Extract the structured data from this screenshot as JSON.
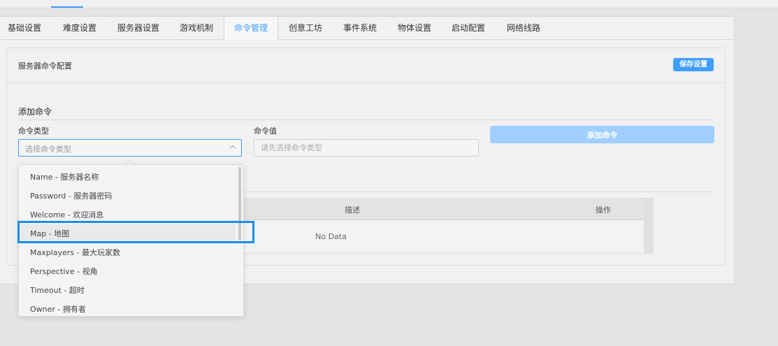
{
  "tabs": [
    {
      "label": "基础设置"
    },
    {
      "label": "难度设置"
    },
    {
      "label": "服务器设置"
    },
    {
      "label": "游戏机制"
    },
    {
      "label": "命令管理",
      "active": true
    },
    {
      "label": "创意工坊"
    },
    {
      "label": "事件系统"
    },
    {
      "label": "物体设置"
    },
    {
      "label": "启动配置"
    },
    {
      "label": "网络线路"
    }
  ],
  "card": {
    "title": "服务器命令配置",
    "save_label": "保存设置"
  },
  "add_section": {
    "title": "添加命令",
    "type_label": "命令类型",
    "type_placeholder": "选择命令类型",
    "value_label": "命令值",
    "value_placeholder": "请先选择命令类型",
    "add_label": "添加命令"
  },
  "table": {
    "col_desc": "描述",
    "col_action": "操作",
    "empty_text": "No Data"
  },
  "dropdown": {
    "options": [
      "Name - 服务器名称",
      "Password - 服务器密码",
      "Welcome - 欢迎消息",
      "Map - 地图",
      "Maxplayers - 最大玩家数",
      "Perspective - 视角",
      "Timeout - 超时",
      "Owner - 拥有者"
    ],
    "highlighted_index": 3
  },
  "colors": {
    "accent": "#409eff",
    "accent_disabled": "#a0cfff",
    "highlight_border": "#1a8ee8"
  }
}
